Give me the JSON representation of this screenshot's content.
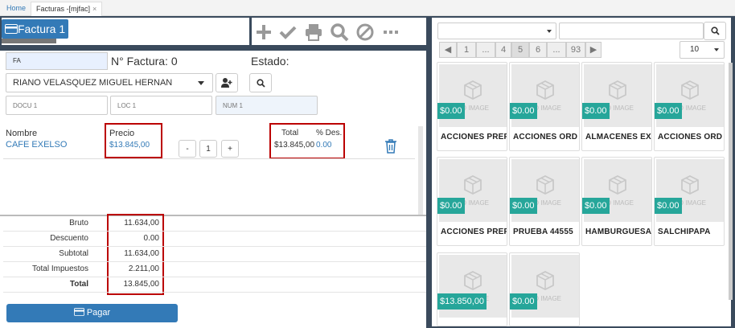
{
  "tabs": {
    "home": "Home",
    "active": "Facturas -[mjfac]",
    "close": "×"
  },
  "header": {
    "title": "Factura 1"
  },
  "toolbar": {
    "add": "add",
    "confirm": "confirm",
    "print": "print",
    "search": "search",
    "cancel": "cancel",
    "more": "more"
  },
  "form": {
    "doc_type": "FA",
    "factura_label": "N° Factura: 0",
    "estado_label": "Estado:",
    "customer": "RIANO VELASQUEZ MIGUEL HERNAN",
    "docu_placeholder": "DOCU 1",
    "loc_placeholder": "LOC 1",
    "num_placeholder": "NUM 1"
  },
  "line_item": {
    "nombre_label": "Nombre",
    "nombre": "CAFE EXELSO",
    "precio_label": "Precio",
    "precio": "$13.845,00",
    "minus": "-",
    "qty": "1",
    "plus": "+",
    "total_label": "Total",
    "total": "$13.845,00",
    "desc_label": "% Des.",
    "desc": "0.00"
  },
  "summary": {
    "bruto_label": "Bruto",
    "bruto": "11.634,00",
    "descuento_label": "Descuento",
    "descuento": "0.00",
    "subtotal_label": "Subtotal",
    "subtotal": "11.634,00",
    "impuestos_label": "Total Impuestos",
    "impuestos": "2.211,00",
    "total_label": "Total",
    "total": "13.845,00"
  },
  "pay_button": "Pagar",
  "catalog": {
    "pagination": [
      "1",
      "...",
      "4",
      "5",
      "6",
      "...",
      "93"
    ],
    "active_page": "5",
    "page_size": "10",
    "noimage_text": "NO IMAGE",
    "products": [
      {
        "name": "ACCIONES PREF",
        "price": "$0.00"
      },
      {
        "name": "ACCIONES ORD",
        "price": "$0.00"
      },
      {
        "name": "ALMACENES EX",
        "price": "$0.00"
      },
      {
        "name": "ACCIONES ORD",
        "price": "$0.00"
      },
      {
        "name": "ACCIONES PREF",
        "price": "$0.00"
      },
      {
        "name": "PRUEBA 44555",
        "price": "$0.00"
      },
      {
        "name": "HAMBURGUESA",
        "price": "$0.00"
      },
      {
        "name": "SALCHIPAPA",
        "price": "$0.00"
      },
      {
        "name": "",
        "price": "$13.850,00"
      },
      {
        "name": "",
        "price": "$0.00"
      }
    ]
  },
  "colors": {
    "primary": "#337ab7",
    "dark_frame": "#3a4a5c",
    "price_badge": "#26a69a",
    "highlight_box": "#b00000"
  }
}
